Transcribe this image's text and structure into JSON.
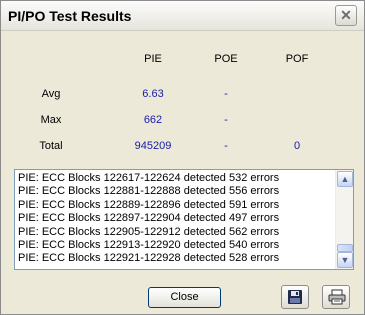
{
  "window": {
    "title": "PI/PO Test Results"
  },
  "table": {
    "headers": [
      "PIE",
      "POE",
      "POF"
    ],
    "rows": [
      {
        "label": "Avg",
        "pie": "6.63",
        "poe": "-",
        "pof": ""
      },
      {
        "label": "Max",
        "pie": "662",
        "poe": "-",
        "pof": ""
      },
      {
        "label": "Total",
        "pie": "945209",
        "poe": "-",
        "pof": "0"
      }
    ]
  },
  "log": {
    "lines": [
      "PIE: ECC Blocks 122617-122624 detected 532 errors",
      "PIE: ECC Blocks 122881-122888 detected 556 errors",
      "PIE: ECC Blocks 122889-122896 detected 591 errors",
      "PIE: ECC Blocks 122897-122904 detected 497 errors",
      "PIE: ECC Blocks 122905-122912 detected 562 errors",
      "PIE: ECC Blocks 122913-122920 detected 540 errors",
      "PIE: ECC Blocks 122921-122928 detected 528 errors"
    ]
  },
  "buttons": {
    "close_label": "Close"
  },
  "icons": {
    "title_close": "close-icon",
    "save": "floppy-disk-icon",
    "print": "printer-icon"
  },
  "colors": {
    "value_blue": "#1a1aa8",
    "log_border": "#7f9db9"
  }
}
